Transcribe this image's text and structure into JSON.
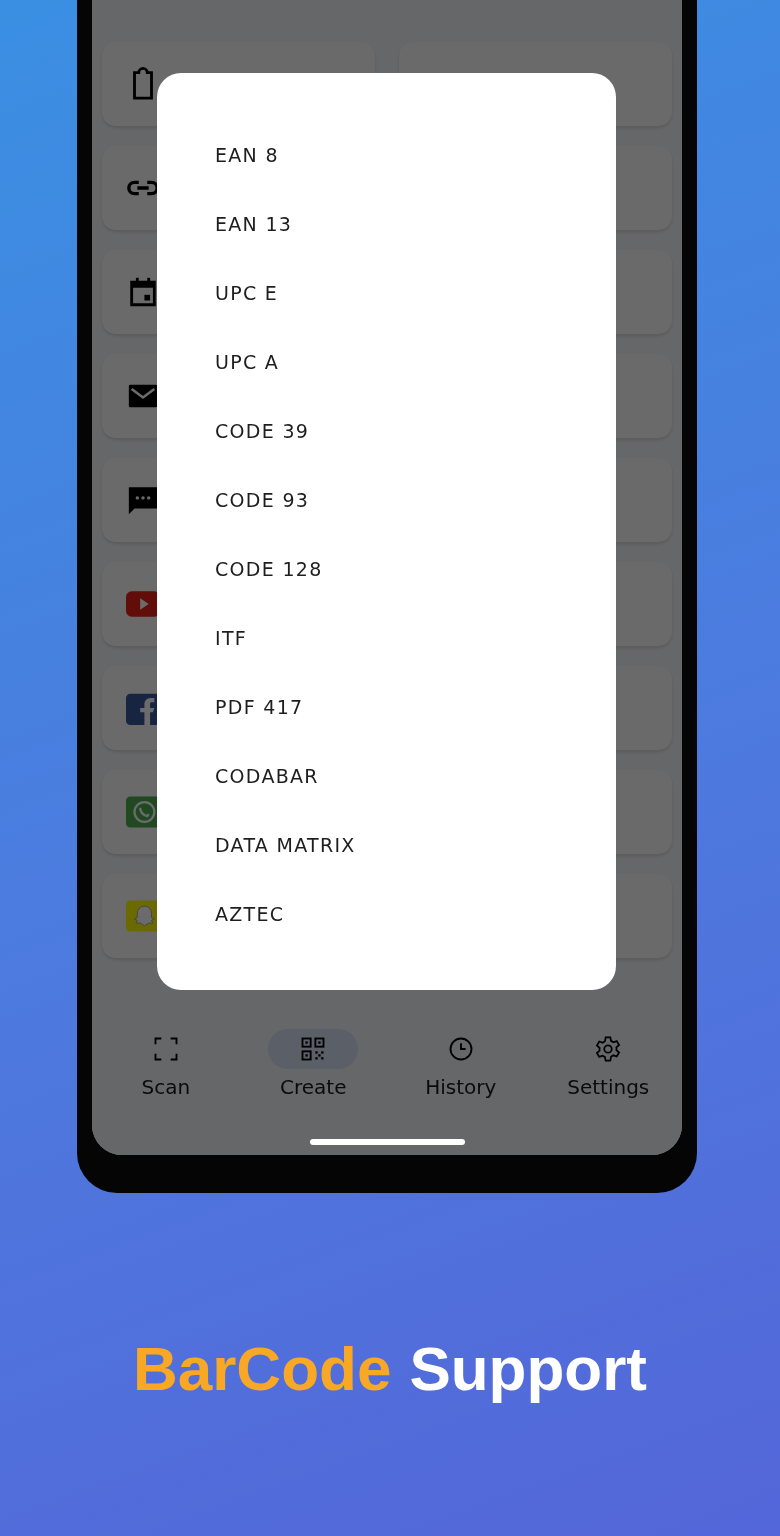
{
  "background_cards": [
    {
      "kind": "clipboard"
    },
    {
      "kind": "blank"
    },
    {
      "kind": "link"
    },
    {
      "kind": "blank"
    },
    {
      "kind": "calendar"
    },
    {
      "kind": "blank"
    },
    {
      "kind": "email"
    },
    {
      "kind": "blank"
    },
    {
      "kind": "sms"
    },
    {
      "kind": "blank"
    },
    {
      "kind": "youtube"
    },
    {
      "kind": "blank"
    },
    {
      "kind": "facebook"
    },
    {
      "kind": "blank"
    },
    {
      "kind": "whatsapp"
    },
    {
      "kind": "blank"
    },
    {
      "kind": "snapchat"
    },
    {
      "kind": "blank"
    }
  ],
  "dialog": {
    "items": [
      "EAN 8",
      "EAN 13",
      "UPC E",
      "UPC A",
      "CODE 39",
      "CODE 93",
      "CODE 128",
      "ITF",
      "PDF 417",
      "CODABAR",
      "DATA MATRIX",
      "AZTEC"
    ]
  },
  "bottom_nav": [
    {
      "label": "Scan",
      "kind": "scan",
      "selected": false
    },
    {
      "label": "Create",
      "kind": "qr",
      "selected": true
    },
    {
      "label": "History",
      "kind": "history",
      "selected": false
    },
    {
      "label": "Settings",
      "kind": "settings",
      "selected": false
    }
  ],
  "caption": {
    "highlight": "BarCode",
    "rest": "Support"
  }
}
